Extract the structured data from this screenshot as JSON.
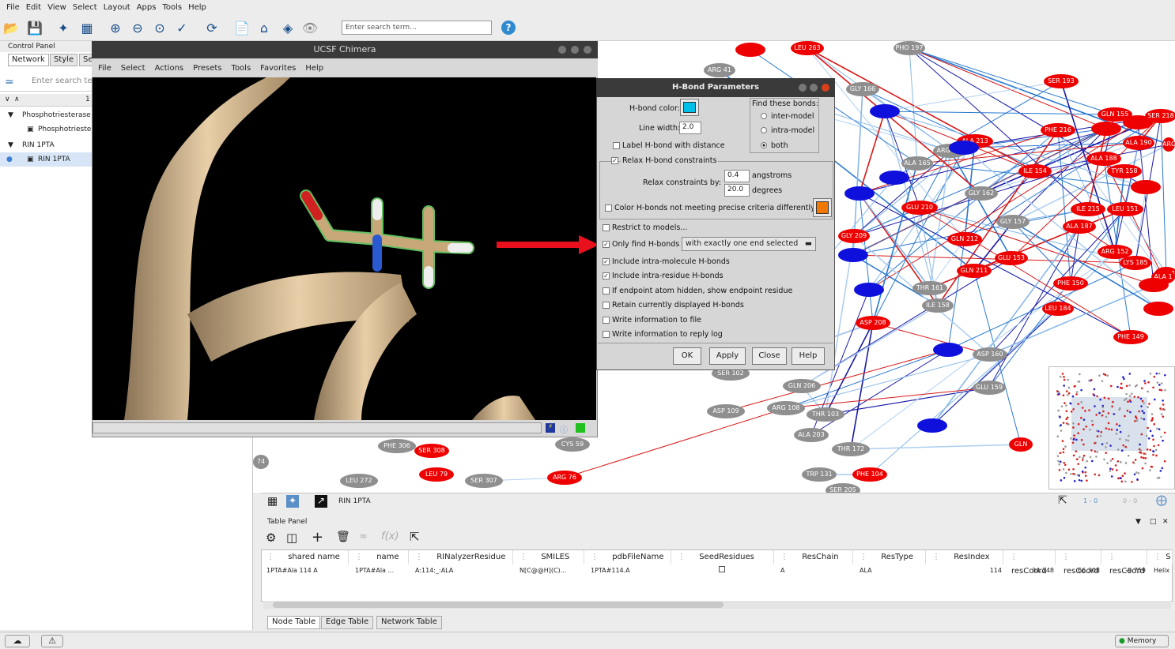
{
  "menubar": [
    "File",
    "Edit",
    "View",
    "Select",
    "Layout",
    "Apps",
    "Tools",
    "Help"
  ],
  "search": {
    "placeholder": "Enter search term..."
  },
  "control_panel": {
    "title": "Control Panel",
    "tabs": [
      "Network",
      "Style",
      "Se"
    ],
    "search_placeholder": "Enter search te",
    "count": "1",
    "tree": [
      {
        "label": "Phosphotriesterase",
        "level": 0
      },
      {
        "label": "Phosphotrieste",
        "level": 1
      },
      {
        "label": "RIN 1PTA",
        "level": 0
      },
      {
        "label": "RIN 1PTA",
        "level": 1
      }
    ]
  },
  "chimera": {
    "title": "UCSF Chimera",
    "menu": [
      "File",
      "Select",
      "Actions",
      "Presets",
      "Tools",
      "Favorites",
      "Help"
    ]
  },
  "hbond": {
    "title": "H-Bond Parameters",
    "color_label": "H-bond color:",
    "color": "#00bfe8",
    "line_width_label": "Line width:",
    "line_width": "2.0",
    "find_label": "Find these bonds:",
    "find_options": [
      "inter-model",
      "intra-model",
      "both"
    ],
    "find_selected": "both",
    "label_distance": "Label H-bond with distance",
    "relax": "Relax H-bond constraints",
    "relax_by": "Relax constraints by:",
    "angstroms_value": "0.4",
    "angstroms": "angstroms",
    "degrees_value": "20.0",
    "degrees": "degrees",
    "color_not_meeting": "Color H-bonds not meeting precise criteria differently:",
    "not_meeting_color": "#f07800",
    "restrict": "Restrict to models...",
    "only_find": "Only find H-bonds",
    "only_find_option": "with exactly one end selected",
    "intra_molecule": "Include intra-molecule H-bonds",
    "intra_residue": "Include intra-residue H-bonds",
    "endpoint_hidden": "If endpoint atom hidden, show endpoint residue",
    "retain": "Retain currently displayed H-bonds",
    "write_file": "Write information to file",
    "write_log": "Write information to reply log",
    "buttons": [
      "OK",
      "Apply",
      "Close",
      "Help"
    ]
  },
  "network_nodes": [
    {
      "label": "PHO 197",
      "c": "gray"
    },
    {
      "label": "LEU 263",
      "c": "red"
    },
    {
      "label": "SER 193",
      "c": "red"
    },
    {
      "label": "ARG 41",
      "c": "gray"
    },
    {
      "label": "GLY 166",
      "c": "gray"
    },
    {
      "label": "GLN 155",
      "c": "red"
    },
    {
      "label": "SER 218",
      "c": "red"
    },
    {
      "label": "PHE 216",
      "c": "red"
    },
    {
      "label": "ALA 213",
      "c": "red"
    },
    {
      "label": "ARG 164",
      "c": "gray"
    },
    {
      "label": "ALA 190",
      "c": "red"
    },
    {
      "label": "ALA 188",
      "c": "red"
    },
    {
      "label": "ALA 165",
      "c": "gray"
    },
    {
      "label": "ILE 154",
      "c": "red"
    },
    {
      "label": "TYR 158",
      "c": "red"
    },
    {
      "label": "GLY 162",
      "c": "gray"
    },
    {
      "label": "GLU 210",
      "c": "red"
    },
    {
      "label": "ILE 215",
      "c": "red"
    },
    {
      "label": "LEU 151",
      "c": "red"
    },
    {
      "label": "GLY 157",
      "c": "gray"
    },
    {
      "label": "ALA 187",
      "c": "red"
    },
    {
      "label": "GLY 209",
      "c": "red"
    },
    {
      "label": "GLN 212",
      "c": "red"
    },
    {
      "label": "GLU 153",
      "c": "red"
    },
    {
      "label": "ARG 152",
      "c": "red"
    },
    {
      "label": "LYS 185",
      "c": "red"
    },
    {
      "label": "GLN 211",
      "c": "red"
    },
    {
      "label": "ALA 1",
      "c": "red"
    },
    {
      "label": "THR 161",
      "c": "gray"
    },
    {
      "label": "PHE 150",
      "c": "red"
    },
    {
      "label": "ILE 158",
      "c": "gray"
    },
    {
      "label": "LEU 184",
      "c": "red"
    },
    {
      "label": "ASP 208",
      "c": "red"
    },
    {
      "label": "PHE 149",
      "c": "red"
    },
    {
      "label": "ASP 160",
      "c": "gray"
    },
    {
      "label": "GLU 159",
      "c": "gray"
    },
    {
      "label": "SER 102",
      "c": "gray"
    },
    {
      "label": "GLN 206",
      "c": "gray"
    },
    {
      "label": "ASP 109",
      "c": "gray"
    },
    {
      "label": "ARG 108",
      "c": "gray"
    },
    {
      "label": "THR 103",
      "c": "gray"
    },
    {
      "label": "ALA 203",
      "c": "gray"
    },
    {
      "label": "THR 172",
      "c": "gray"
    },
    {
      "label": "PHE 306",
      "c": "gray"
    },
    {
      "label": "SER 308",
      "c": "red"
    },
    {
      "label": "CYS 59",
      "c": "gray"
    },
    {
      "label": "LEU 79",
      "c": "red"
    },
    {
      "label": "SER 307",
      "c": "gray"
    },
    {
      "label": "LEU 272",
      "c": "gray"
    },
    {
      "label": "ARG 76",
      "c": "red"
    },
    {
      "label": "TRP 131",
      "c": "gray"
    },
    {
      "label": "PHE 104",
      "c": "red"
    },
    {
      "label": "SER 205",
      "c": "gray"
    },
    {
      "label": "74",
      "c": "gray"
    },
    {
      "label": "GLN",
      "c": "red"
    },
    {
      "label": "ARG",
      "c": "red"
    },
    {
      "label": "ALA 1",
      "c": "red"
    }
  ],
  "network_toolbar": {
    "name": "RIN 1PTA",
    "counts1": "1 - 0",
    "counts2": "0 - 0"
  },
  "table_panel": {
    "title": "Table Panel",
    "columns": [
      "shared name",
      "name",
      "RINalyzerResidue",
      "SMILES",
      "pdbFileName",
      "SeedResidues",
      "ResChain",
      "ResType",
      "ResIndex",
      "resCoord",
      "resCoord",
      "resCoord",
      "S"
    ],
    "row": [
      "1PTA#Ala 114 A",
      "1PTA#Ala ...",
      "A:114:_:ALA",
      "N[C@@H](C)...",
      "1PTA#114.A",
      "",
      "A",
      "ALA",
      "114",
      "34.148",
      "66.308",
      "-9.759",
      "Helix"
    ],
    "tabs": [
      "Node Table",
      "Edge Table",
      "Network Table"
    ]
  },
  "status": {
    "memory": "Memory"
  }
}
